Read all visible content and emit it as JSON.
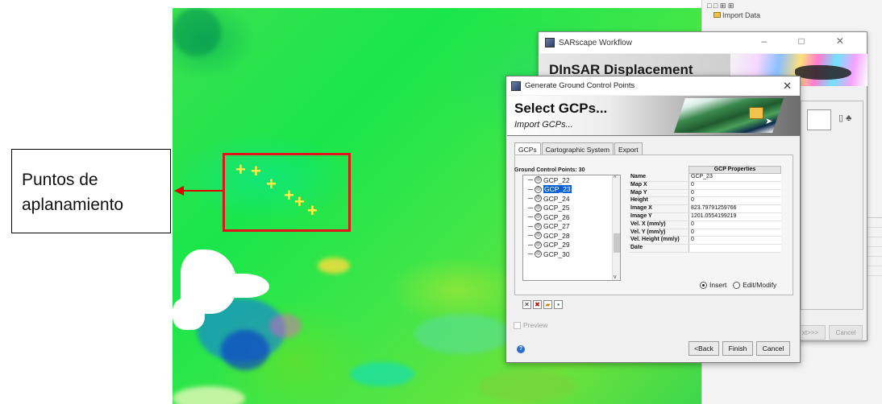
{
  "annotation": {
    "label_line1": "Puntos de",
    "label_line2": "aplanamiento",
    "highlight_color": "#e0141a"
  },
  "gcp_markers": [
    "+",
    "+",
    "+",
    "+",
    "+",
    "+"
  ],
  "explorer": {
    "item": "Import Data"
  },
  "workflow_window": {
    "title": "SARscape Workflow",
    "heading": "DInSAR Displacement",
    "next_button": "xt>>>",
    "cancel_button": "Cancel"
  },
  "dialog": {
    "title": "Generate Ground Control Points",
    "heading": "Select GCPs...",
    "subheading": "Import GCPs...",
    "tabs": [
      "GCPs",
      "Cartographic System",
      "Export"
    ],
    "gcp_count_label": "Ground Control Points: 30",
    "gcp_list": [
      "GCP_22",
      "GCP_23",
      "GCP_24",
      "GCP_25",
      "GCP_26",
      "GCP_27",
      "GCP_28",
      "GCP_29",
      "GCP_30"
    ],
    "selected_gcp": "GCP_23",
    "properties_header": "GCP Properties",
    "properties": [
      {
        "name": "Name",
        "value": "GCP_23"
      },
      {
        "name": "Map X",
        "value": "0"
      },
      {
        "name": "Map Y",
        "value": "0"
      },
      {
        "name": "Height",
        "value": "0"
      },
      {
        "name": "Image X",
        "value": "823.79791259766"
      },
      {
        "name": "Image Y",
        "value": "1201.0554199219"
      },
      {
        "name": "Vel. X (mm/y)",
        "value": "0"
      },
      {
        "name": "Vel. Y (mm/y)",
        "value": "0"
      },
      {
        "name": "Vel. Height (mm/y)",
        "value": "0"
      },
      {
        "name": "Date",
        "value": ""
      }
    ],
    "mode_options": [
      "Insert",
      "Edit/Modify"
    ],
    "selected_mode": "Insert",
    "preview_label": "Preview",
    "buttons": {
      "back": "<Back",
      "finish": "Finish",
      "cancel": "Cancel"
    }
  }
}
